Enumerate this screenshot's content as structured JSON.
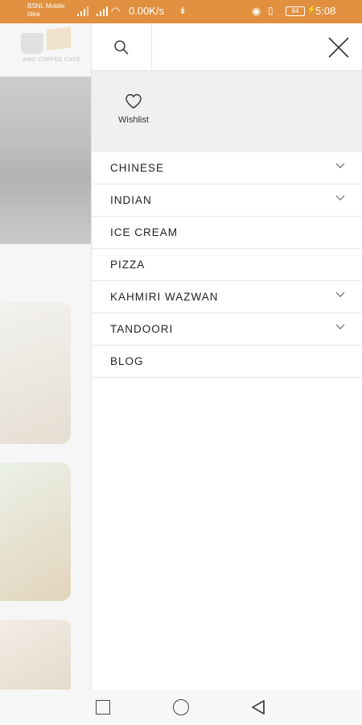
{
  "status_bar": {
    "carrier": "BSNL Mobile Idea",
    "net_speed": "0.00K/s",
    "battery": "64",
    "time": "5:08"
  },
  "background": {
    "logo_text": "AMO COFFEE CAFE"
  },
  "drawer": {
    "wishlist_label": "Wishlist",
    "menu": [
      {
        "label": "CHINESE",
        "has_submenu": true
      },
      {
        "label": "INDIAN",
        "has_submenu": true
      },
      {
        "label": "ICE CREAM",
        "has_submenu": false
      },
      {
        "label": "PIZZA",
        "has_submenu": false
      },
      {
        "label": "KAHMIRI WAZWAN",
        "has_submenu": true
      },
      {
        "label": "TANDOORI",
        "has_submenu": true
      },
      {
        "label": "BLOG",
        "has_submenu": false
      }
    ]
  },
  "icons": {
    "search": "search-icon",
    "close": "close-icon",
    "wishlist": "heart-icon",
    "expand": "chevron-down-icon"
  },
  "colors": {
    "status_bar": "#e1903f",
    "wish_area": "#f0f0f0"
  }
}
